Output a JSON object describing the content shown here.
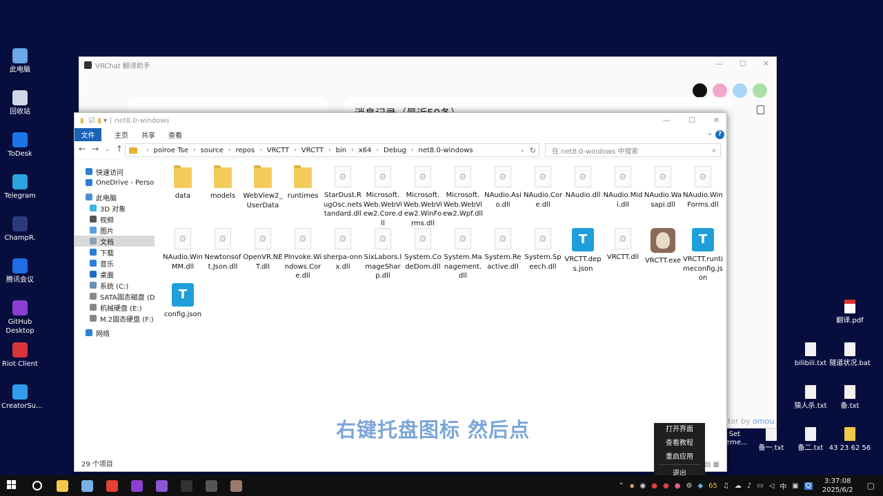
{
  "desktop": {
    "left_icons": [
      {
        "label": "此电脑",
        "icon": "computer-icon",
        "color": "#6aa8e8"
      },
      {
        "label": "回收站",
        "icon": "recycle-bin-icon",
        "color": "#cfd8e8"
      },
      {
        "label": "ToDesk",
        "icon": "todesk-icon",
        "color": "#1c74e8"
      },
      {
        "label": "Telegram",
        "icon": "telegram-icon",
        "color": "#2aa3e0"
      },
      {
        "label": "ChampR.",
        "icon": "champr-icon",
        "color": "#2b3a7a"
      },
      {
        "label": "腾讯会议",
        "icon": "tencent-meeting-icon",
        "color": "#1f6de0"
      },
      {
        "label": "GitHub Desktop",
        "icon": "github-desktop-icon",
        "color": "#8b3fd0"
      },
      {
        "label": "Riot Client",
        "icon": "riot-client-icon",
        "color": "#d8343a"
      },
      {
        "label": "CreatorSu...",
        "icon": "creator-suite-icon",
        "color": "#2f9ee8"
      }
    ],
    "right_files": [
      {
        "label": "翻译.pdf",
        "type": "pdf"
      },
      {
        "label": "bilibili.txt",
        "type": "txt"
      },
      {
        "label": "隧道状况.bat",
        "type": "bat"
      },
      {
        "label": "txt",
        "type": "txt"
      },
      {
        "label": "猿人杀.txt",
        "type": "txt"
      },
      {
        "label": "备.txt",
        "type": "txt"
      },
      {
        "label": "Set\nceme...",
        "type": "txt"
      },
      {
        "label": "备一.txt",
        "type": "txt"
      },
      {
        "label": "备二.txt",
        "type": "txt"
      },
      {
        "label": "43 23 62 56",
        "type": "folder"
      }
    ]
  },
  "vrchat_window": {
    "title": "VRChat 翻译助手",
    "controls": [
      "—",
      "☐",
      "✕"
    ],
    "color_dots": [
      "#111111",
      "#f2a6c8",
      "#a8d6f8",
      "#a8e0a8"
    ],
    "partial_heading": "消息记录（最近50条）",
    "credit_prefix": "tor by",
    "credit_name": "omou"
  },
  "explorer": {
    "title": "net8.0-windows",
    "controls": [
      "—",
      "☐",
      "✕"
    ],
    "ribbon": {
      "file": "文件",
      "tabs": [
        "主页",
        "共享",
        "查看"
      ],
      "help": "?"
    },
    "breadcrumb": [
      "poiroe Tse",
      "source",
      "repos",
      "VRCTT",
      "VRCTT",
      "bin",
      "x64",
      "Debug",
      "net8.0-windows"
    ],
    "search_placeholder": "在 net8.0-windows 中搜索",
    "nav_pane": [
      {
        "label": "快速访问",
        "icon": "star-icon",
        "color": "#2b7fd8",
        "level": 0
      },
      {
        "label": "OneDrive - Persona",
        "icon": "onedrive-icon",
        "color": "#2b7fd8",
        "level": 0
      },
      {
        "label": "此电脑",
        "icon": "computer-icon",
        "color": "#4a90d9",
        "level": 0
      },
      {
        "label": "3D 对象",
        "icon": "3d-objects-icon",
        "color": "#3fb3e0",
        "level": 1
      },
      {
        "label": "视频",
        "icon": "videos-icon",
        "color": "#555555",
        "level": 1
      },
      {
        "label": "图片",
        "icon": "pictures-icon",
        "color": "#5aa0e0",
        "level": 1
      },
      {
        "label": "文档",
        "icon": "documents-icon",
        "color": "#8aa0b8",
        "level": 1,
        "selected": true
      },
      {
        "label": "下载",
        "icon": "downloads-icon",
        "color": "#2b7fd8",
        "level": 1
      },
      {
        "label": "音乐",
        "icon": "music-icon",
        "color": "#2b7fd8",
        "level": 1
      },
      {
        "label": "桌面",
        "icon": "desktop-icon",
        "color": "#1f6fc0",
        "level": 1
      },
      {
        "label": "系统 (C:)",
        "icon": "drive-c-icon",
        "color": "#6b8fb0",
        "level": 1
      },
      {
        "label": "SATA固态磁盘 (D:)",
        "icon": "drive-d-icon",
        "color": "#888888",
        "level": 1
      },
      {
        "label": "机械硬盘 (E:)",
        "icon": "drive-e-icon",
        "color": "#888888",
        "level": 1
      },
      {
        "label": "M.2固态硬盘 (F:)",
        "icon": "drive-f-icon",
        "color": "#888888",
        "level": 1
      },
      {
        "label": "网络",
        "icon": "network-icon",
        "color": "#2b7fd8",
        "level": 0
      }
    ],
    "files": [
      {
        "name": "data",
        "type": "folder"
      },
      {
        "name": "models",
        "type": "folder"
      },
      {
        "name": "WebView2_UserData",
        "type": "folder"
      },
      {
        "name": "runtimes",
        "type": "folder"
      },
      {
        "name": "StarDust.RugOsc.netstandard.dll",
        "type": "dll"
      },
      {
        "name": "Microsoft.Web.WebView2.Core.dll",
        "type": "dll"
      },
      {
        "name": "Microsoft.Web.WebView2.WinForms.dll",
        "type": "dll"
      },
      {
        "name": "Microsoft.Web.WebView2.Wpf.dll",
        "type": "dll"
      },
      {
        "name": "NAudio.Asio.dll",
        "type": "dll"
      },
      {
        "name": "NAudio.Core.dll",
        "type": "dll"
      },
      {
        "name": "NAudio.dll",
        "type": "dll"
      },
      {
        "name": "NAudio.Midi.dll",
        "type": "dll"
      },
      {
        "name": "NAudio.Wasapi.dll",
        "type": "dll"
      },
      {
        "name": "NAudio.WinForms.dll",
        "type": "dll"
      },
      {
        "name": "NAudio.WinMM.dll",
        "type": "dll"
      },
      {
        "name": "Newtonsoft.Json.dll",
        "type": "dll"
      },
      {
        "name": "OpenVR.NET.dll",
        "type": "dll"
      },
      {
        "name": "PInvoke.Windows.Core.dll",
        "type": "dll"
      },
      {
        "name": "sherpa-onnx.dll",
        "type": "dll"
      },
      {
        "name": "SixLabors.ImageSharp.dll",
        "type": "dll"
      },
      {
        "name": "System.CodeDom.dll",
        "type": "dll"
      },
      {
        "name": "System.Management.dll",
        "type": "dll"
      },
      {
        "name": "System.Reactive.dll",
        "type": "dll"
      },
      {
        "name": "System.Speech.dll",
        "type": "dll"
      },
      {
        "name": "VRCTT.deps.json",
        "type": "json"
      },
      {
        "name": "VRCTT.dll",
        "type": "dll"
      },
      {
        "name": "VRCTT.exe",
        "type": "exe"
      },
      {
        "name": "VRCTT.runtimeconfig.json",
        "type": "json"
      },
      {
        "name": "config.json",
        "type": "json"
      }
    ],
    "json_glyph": "T",
    "status": "29 个项目"
  },
  "overlay_caption": "右键托盘图标 然后点",
  "tray_menu": {
    "items": [
      "打开界面",
      "查看教程",
      "重启应用"
    ],
    "exit": "退出"
  },
  "taskbar": {
    "apps": [
      {
        "name": "windows-start-icon",
        "color": "#ffffff"
      },
      {
        "name": "cortana-search-icon",
        "color": "#ffffff"
      },
      {
        "name": "file-explorer-icon",
        "color": "#f2c94c"
      },
      {
        "name": "computer-management-icon",
        "color": "#7ab0e8"
      },
      {
        "name": "chrome-icon",
        "color": "#e34133"
      },
      {
        "name": "github-desktop-icon",
        "color": "#8b3fd0"
      },
      {
        "name": "visual-studio-icon",
        "color": "#8a55d6"
      },
      {
        "name": "obs-icon",
        "color": "#333333"
      },
      {
        "name": "vr-app-icon",
        "color": "#555555"
      },
      {
        "name": "vrchat-translator-icon",
        "color": "#9a7a6a"
      }
    ],
    "tray_number": "65",
    "ime": "中",
    "time": "3:37:08",
    "date": "2025/6/2"
  }
}
